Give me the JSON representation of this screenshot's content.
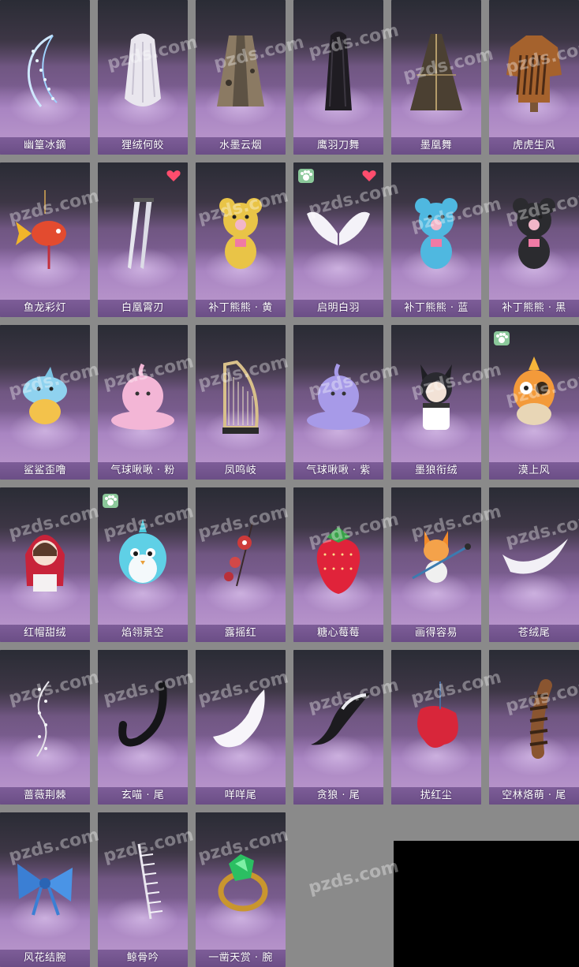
{
  "watermark_text": "pzds.com",
  "colors": {
    "page_background": "#8a8a8a",
    "label_bar": "#6b4e86",
    "label_text": "#ffffff",
    "redacted_block": "#000000",
    "paw_badge": "#8bc89a",
    "heart_badge": "#ff4d6d"
  },
  "items": [
    {
      "label": "幽篁冰鏑",
      "icon": "ice-bow-icon",
      "badge": null
    },
    {
      "label": "狸绒何皎",
      "icon": "white-hair-icon",
      "badge": null
    },
    {
      "label": "水墨云烟",
      "icon": "ink-robe-icon",
      "badge": null
    },
    {
      "label": "鹰羽刀舞",
      "icon": "black-hair-icon",
      "badge": null
    },
    {
      "label": "墨凰舞",
      "icon": "dark-gown-icon",
      "badge": null
    },
    {
      "label": "虎虎生风",
      "icon": "tiger-coat-icon",
      "badge": null
    },
    {
      "label": "鱼龙彩灯",
      "icon": "fish-lantern-icon",
      "badge": null
    },
    {
      "label": "白凰霄刃",
      "icon": "twin-blades-icon",
      "badge": "heart"
    },
    {
      "label": "补丁熊熊 · 黄",
      "icon": "yellow-bear-icon",
      "badge": null
    },
    {
      "label": "启明白羽",
      "icon": "white-wings-icon",
      "badge": "paw-heart"
    },
    {
      "label": "补丁熊熊 · 蓝",
      "icon": "blue-bear-icon",
      "badge": null
    },
    {
      "label": "补丁熊熊 · 黑",
      "icon": "black-bear-icon",
      "badge": null
    },
    {
      "label": "鲨鲨歪噜",
      "icon": "shark-pet-icon",
      "badge": null
    },
    {
      "label": "气球啾啾 · 粉",
      "icon": "pink-slime-icon",
      "badge": null
    },
    {
      "label": "凤鸣岐",
      "icon": "harp-icon",
      "badge": null
    },
    {
      "label": "气球啾啾 · 紫",
      "icon": "purple-slime-icon",
      "badge": null
    },
    {
      "label": "墨狼衔绒",
      "icon": "wolf-doll-icon",
      "badge": null
    },
    {
      "label": "漠上风",
      "icon": "owl-pet-icon",
      "badge": "paw"
    },
    {
      "label": "红帽甜绒",
      "icon": "red-hood-doll-icon",
      "badge": null
    },
    {
      "label": "焰翎景空",
      "icon": "blue-bird-pet-icon",
      "badge": "paw"
    },
    {
      "label": "露摇红",
      "icon": "red-ornament-icon",
      "badge": null
    },
    {
      "label": "糖心莓莓",
      "icon": "strawberry-icon",
      "badge": null
    },
    {
      "label": "画得容易",
      "icon": "fox-brush-icon",
      "badge": null
    },
    {
      "label": "苍绒尾",
      "icon": "white-tail-icon",
      "badge": null
    },
    {
      "label": "蔷薇荆棘",
      "icon": "thorn-vine-icon",
      "badge": null
    },
    {
      "label": "玄喵 · 尾",
      "icon": "black-cat-tail-icon",
      "badge": null
    },
    {
      "label": "咩咩尾",
      "icon": "fluffy-tail-icon",
      "badge": null
    },
    {
      "label": "贪狼 · 尾",
      "icon": "wolf-tail-icon",
      "badge": null
    },
    {
      "label": "扰红尘",
      "icon": "red-cloth-icon",
      "badge": null
    },
    {
      "label": "空林烙萌 · 尾",
      "icon": "raccoon-tail-icon",
      "badge": null
    },
    {
      "label": "风花结腕",
      "icon": "blue-bow-icon",
      "badge": null
    },
    {
      "label": "鲸骨吟",
      "icon": "bone-charm-icon",
      "badge": null
    },
    {
      "label": "一凿天赏 · 腕",
      "icon": "emerald-ring-icon",
      "badge": null
    }
  ]
}
